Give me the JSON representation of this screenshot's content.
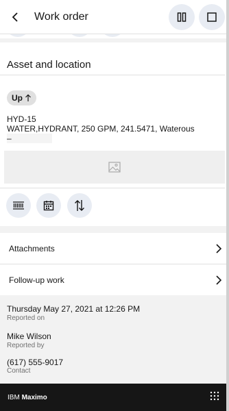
{
  "header": {
    "title": "Work order",
    "back_icon": "chevron-left-icon",
    "buttons": [
      {
        "icon": "pause-icon"
      },
      {
        "icon": "stop-icon"
      }
    ]
  },
  "asset_section": {
    "title": "Asset and location",
    "status": {
      "label": "Up",
      "icon": "arrow-up-icon"
    },
    "asset_number": "HYD-15",
    "asset_description": "WATER,HYDRANT, 250 GPM, 241.5471, Waterous",
    "location": "–",
    "image_placeholder_icon": "image-icon",
    "tools": [
      {
        "name": "barcode-scan",
        "icon": "barcode-icon"
      },
      {
        "name": "calendar",
        "icon": "calendar-icon"
      },
      {
        "name": "sort",
        "icon": "arrows-vertical-icon"
      }
    ]
  },
  "nav_rows": [
    {
      "label": "Attachments",
      "icon": "chevron-right-icon"
    },
    {
      "label": "Follow-up work",
      "icon": "chevron-right-icon"
    }
  ],
  "info": {
    "reported_on": {
      "value": "Thursday May 27, 2021  at  12:26 PM",
      "label": "Reported on"
    },
    "reported_by": {
      "value": "Mike Wilson",
      "label": "Reported by"
    },
    "contact": {
      "value": "(617) 555-9017",
      "label": "Contact"
    }
  },
  "footer": {
    "brand_prefix": "IBM ",
    "brand_name": "Maximo",
    "menu_icon": "app-switcher-grid-icon"
  },
  "colors": {
    "accent_button_bg": "#e8ecf3",
    "footer_bg": "#161616",
    "page_bg": "#f2f2f2"
  }
}
